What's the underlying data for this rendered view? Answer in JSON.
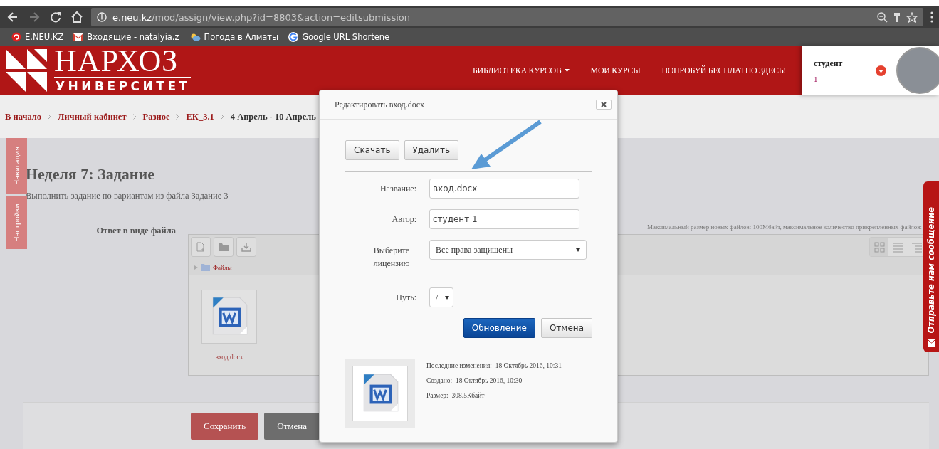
{
  "browser": {
    "url_domain": "e.neu.kz",
    "url_path": "/mod/assign/view.php?id=8803&action=editsubmission",
    "bookmarks": [
      {
        "label": "E.NEU.KZ",
        "kind": "site"
      },
      {
        "label": "Входящие - natalyia.z",
        "kind": "mail"
      },
      {
        "label": "Погода в Алматы",
        "kind": "weather"
      },
      {
        "label": "Google URL Shortene",
        "kind": "google"
      }
    ]
  },
  "header": {
    "logo_title": "НАРХОЗ",
    "logo_subtitle": "УНИВЕРСИТЕТ",
    "nav": [
      {
        "label": "БИБЛИОТЕКА КУРСОВ",
        "dropdown": true
      },
      {
        "label": "МОИ КУРСЫ",
        "dropdown": false
      },
      {
        "label": "ПОПРОБУЙ БЕСПЛАТНО ЗДЕСЬ!",
        "dropdown": false
      }
    ],
    "user": {
      "name": "студент",
      "number": "1"
    }
  },
  "breadcrumb": [
    {
      "label": "В начало",
      "current": false
    },
    {
      "label": "Личный кабинет",
      "current": false
    },
    {
      "label": "Разное",
      "current": false
    },
    {
      "label": "ЕК_3.1",
      "current": false
    },
    {
      "label": "4 Апрель - 10 Апрель",
      "current": true
    }
  ],
  "side_tabs": [
    {
      "label": "Навигация"
    },
    {
      "label": "Настройки"
    }
  ],
  "page": {
    "title": "Неделя 7: Задание",
    "description": "Выполнить задание по вариантам из файла Задание 3",
    "field_label": "Ответ в виде файла",
    "limits_note": "Максимальный размер новых файлов: 100Мбайт, максимальное количество прикрепленных файлов:",
    "file_manager": {
      "path": "Файлы",
      "files": [
        {
          "name": "вход.docx"
        }
      ],
      "views": [
        {
          "kind": "icons",
          "selected": true
        },
        {
          "kind": "list",
          "selected": false
        },
        {
          "kind": "tree",
          "selected": false
        }
      ]
    },
    "buttons": [
      {
        "label": "Сохранить",
        "kind": "primary"
      },
      {
        "label": "Отмена",
        "kind": "secondary"
      }
    ]
  },
  "feedback_tab": {
    "label": "Отправьте нам сообщение"
  },
  "dialog": {
    "title": "Редактировать вход.docx",
    "actions": [
      "Скачать",
      "Удалить"
    ],
    "fields": [
      {
        "kind": "text",
        "label": "Название:",
        "value": "вход.docx"
      },
      {
        "kind": "text",
        "label": "Автор:",
        "value": "студент 1"
      },
      {
        "kind": "select",
        "label": "Выберите лицензию",
        "value": "Все права защищены",
        "wide": true
      },
      {
        "kind": "select",
        "label": "Путь:",
        "value": "/",
        "wide": false
      }
    ],
    "buttons": [
      {
        "label": "Обновление",
        "kind": "primary"
      },
      {
        "label": "Отмена",
        "kind": "default"
      }
    ],
    "info": [
      {
        "label": "Последние изменения:",
        "value": "18 Октябрь 2016, 10:31"
      },
      {
        "label": "Создано:",
        "value": "18 Октябрь 2016, 10:30"
      },
      {
        "label": "Размер:",
        "value": "308.5Кбайт"
      }
    ]
  }
}
